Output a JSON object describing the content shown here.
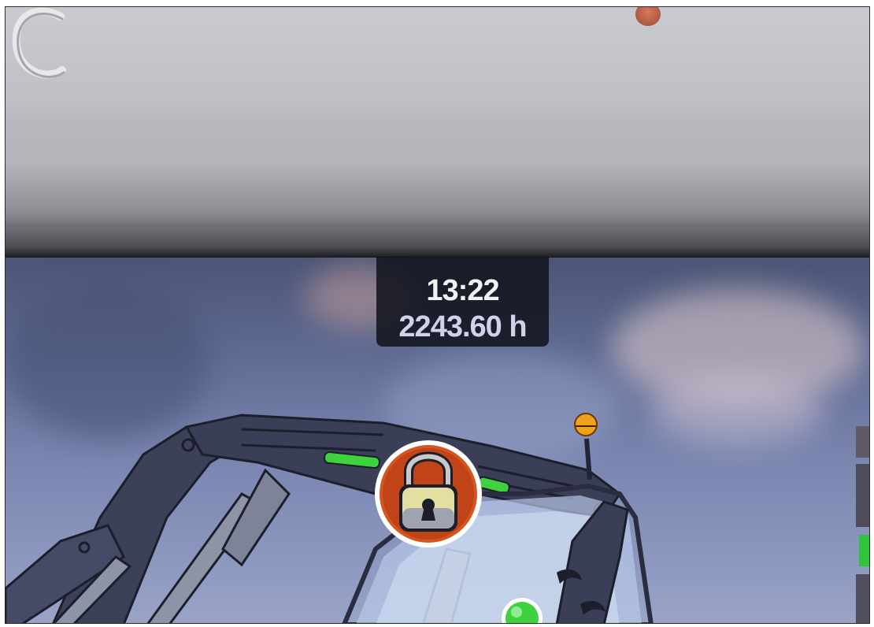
{
  "display": {
    "clock_time": "13:22",
    "operating_hours": "2243.60 h"
  },
  "icons": {
    "lock": "padlock-locked-icon",
    "joystick": "joystick-icon",
    "indicator_green": "green-indicator-light"
  },
  "colors": {
    "bezel": "#bfc1c6",
    "screen_bg": "#6f7aa0",
    "panel_bg": "#12141e",
    "lock_ring": "#d5551e",
    "lock_body": "#e2dfa0",
    "indicator_green": "#3fd23f",
    "machine_body": "#3c4058"
  }
}
